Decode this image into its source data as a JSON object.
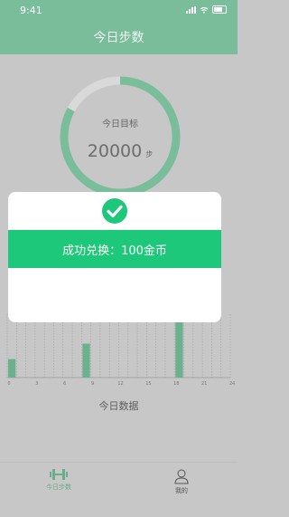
{
  "status_bar": {
    "time": "9:41"
  },
  "header": {
    "title": "今日步数"
  },
  "goal": {
    "label": "今日目标",
    "value": "20000",
    "unit": "步",
    "progress_fraction": 0.83
  },
  "chart_data": {
    "type": "bar",
    "xlabel": "",
    "ylabel": "",
    "x": [
      0,
      1,
      2,
      3,
      4,
      5,
      6,
      7,
      8,
      9,
      10,
      11,
      12,
      13,
      14,
      15,
      16,
      17,
      18,
      19,
      20,
      21,
      22,
      23
    ],
    "values": [
      0.3,
      0,
      0,
      0,
      0,
      0,
      0,
      0,
      0.55,
      0,
      0,
      0,
      0,
      0,
      0,
      0,
      0,
      0,
      1.0,
      0,
      0,
      0,
      0,
      0
    ],
    "tick_labels": [
      "0",
      "3",
      "6",
      "9",
      "12",
      "15",
      "18",
      "21",
      "24"
    ],
    "grid": true
  },
  "chart_caption": "今日数据",
  "tabs": [
    {
      "label": "今日步数",
      "icon": "dumbbell-icon",
      "active": true
    },
    {
      "label": "我的",
      "icon": "person-icon",
      "active": false
    }
  ],
  "modal": {
    "message": "成功兑换：100金币",
    "icon": "check-circle-icon"
  },
  "colors": {
    "accent": "#79bd9b",
    "banner": "#1ec87a",
    "bar": "#6cb18e"
  }
}
